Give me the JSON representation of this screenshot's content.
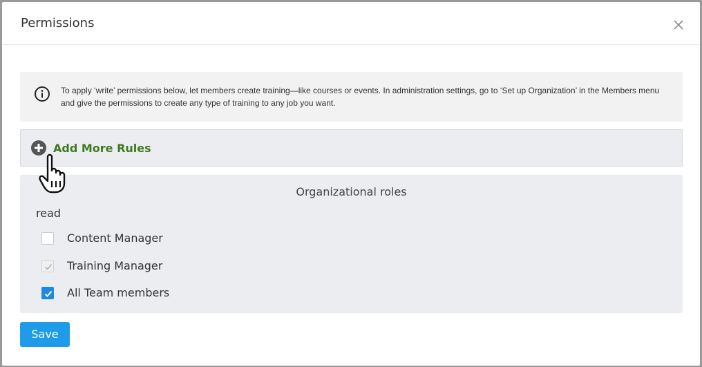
{
  "dialog": {
    "title": "Permissions",
    "close_icon": "close-icon"
  },
  "info": {
    "icon": "info-icon",
    "text": "To apply ‘write’ permissions below, let members create training—like courses or events. In administration settings, go to ‘Set up Organization’ in the Members menu and give the permissions to create any type of training to any job you want."
  },
  "rules": {
    "icon": "plus-circle-icon",
    "label": "Add More Rules",
    "color": "#3e7a1e"
  },
  "roles": {
    "header": "Organizational roles",
    "permission": "read",
    "items": [
      {
        "label": "Content Manager",
        "state": "unchecked"
      },
      {
        "label": "Training Manager",
        "state": "checked-disabled"
      },
      {
        "label": "All Team members",
        "state": "checked"
      }
    ]
  },
  "footer": {
    "save_label": "Save",
    "accent": "#1e9be9"
  }
}
